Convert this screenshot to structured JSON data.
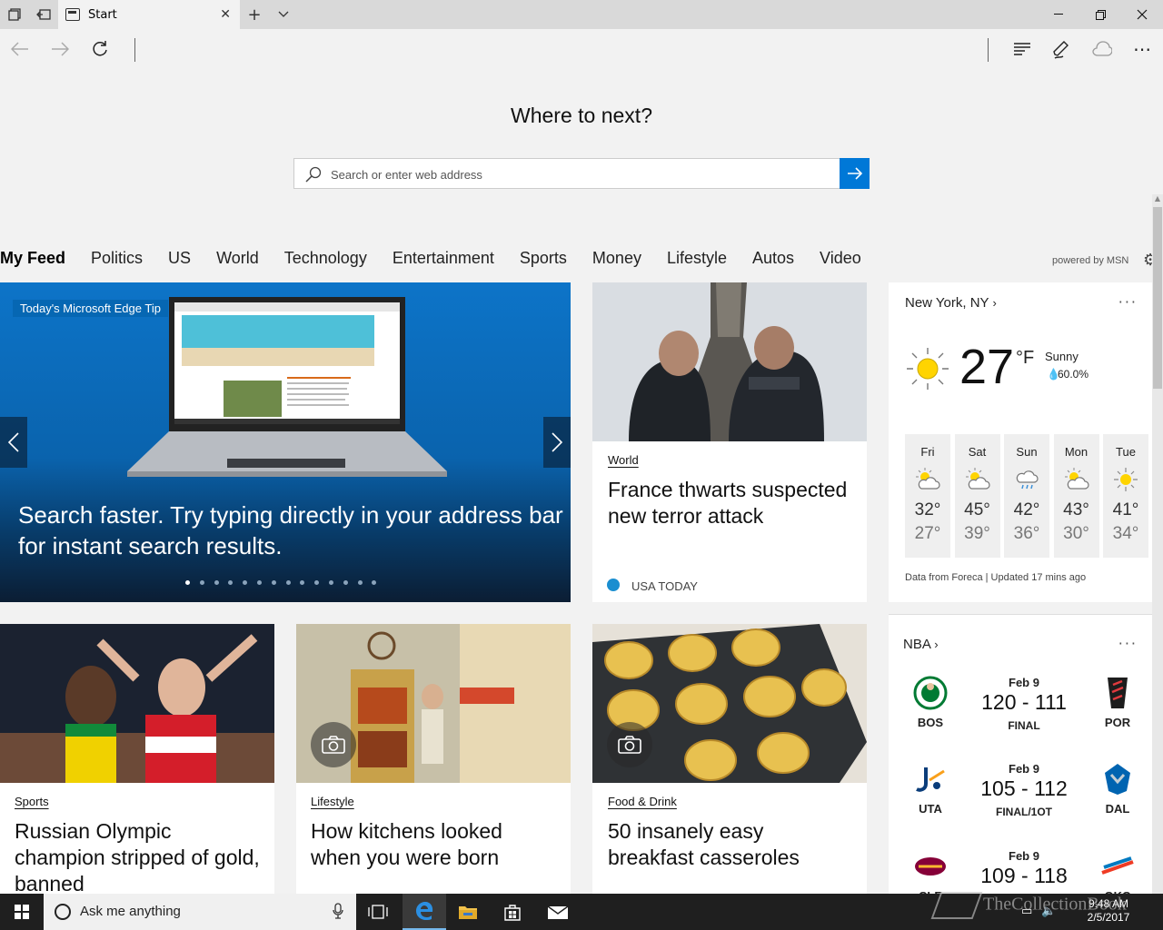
{
  "tab": {
    "title": "Start"
  },
  "hero": {
    "heading": "Where to next?",
    "search_placeholder": "Search or enter web address"
  },
  "nav": {
    "categories": [
      "My Feed",
      "Politics",
      "US",
      "World",
      "Technology",
      "Entertainment",
      "Sports",
      "Money",
      "Lifestyle",
      "Autos",
      "Video"
    ],
    "active": "My Feed",
    "powered_by": "powered by MSN"
  },
  "featured": {
    "badge": "Today's Microsoft Edge Tip",
    "title": "Search faster. Try typing directly in your address bar for instant search results.",
    "dot_count": 14,
    "active_dot": 0
  },
  "cards": {
    "france": {
      "category": "World",
      "title": "France thwarts suspected new terror attack",
      "source": "USA TODAY"
    },
    "russia": {
      "category": "Sports",
      "title": "Russian Olympic champion stripped of gold, banned"
    },
    "kitchens": {
      "category": "Lifestyle",
      "title": "How kitchens looked when you were born"
    },
    "breakfast": {
      "category": "Food & Drink",
      "title": "50 insanely easy breakfast casseroles"
    }
  },
  "weather": {
    "location": "New York, NY",
    "temp": "27",
    "unit": "°F",
    "condition": "Sunny",
    "humidity": "60.0%",
    "forecast": [
      {
        "day": "Fri",
        "hi": "32°",
        "lo": "27°",
        "icon": "partly-sunny-icon"
      },
      {
        "day": "Sat",
        "hi": "45°",
        "lo": "39°",
        "icon": "partly-sunny-icon"
      },
      {
        "day": "Sun",
        "hi": "42°",
        "lo": "36°",
        "icon": "rain-icon"
      },
      {
        "day": "Mon",
        "hi": "43°",
        "lo": "30°",
        "icon": "partly-sunny-icon"
      },
      {
        "day": "Tue",
        "hi": "41°",
        "lo": "34°",
        "icon": "sun-icon"
      }
    ],
    "source": "Data from Foreca | Updated 17 mins ago"
  },
  "nba": {
    "title": "NBA",
    "games": [
      {
        "date": "Feb 9",
        "score": "120 - 111",
        "status": "FINAL",
        "home": "BOS",
        "away": "POR"
      },
      {
        "date": "Feb 9",
        "score": "105 - 112",
        "status": "FINAL/1OT",
        "home": "UTA",
        "away": "DAL"
      },
      {
        "date": "Feb 9",
        "score": "109 - 118",
        "status": "",
        "home": "CLE",
        "away": "OKC"
      }
    ]
  },
  "taskbar": {
    "search_placeholder": "Ask me anything",
    "time": "9:48 AM",
    "date": "2/5/2017"
  },
  "watermark": "TheCollectionBook",
  "colors": {
    "accent": "#0078d7",
    "taskbar": "#1f1f1f"
  }
}
